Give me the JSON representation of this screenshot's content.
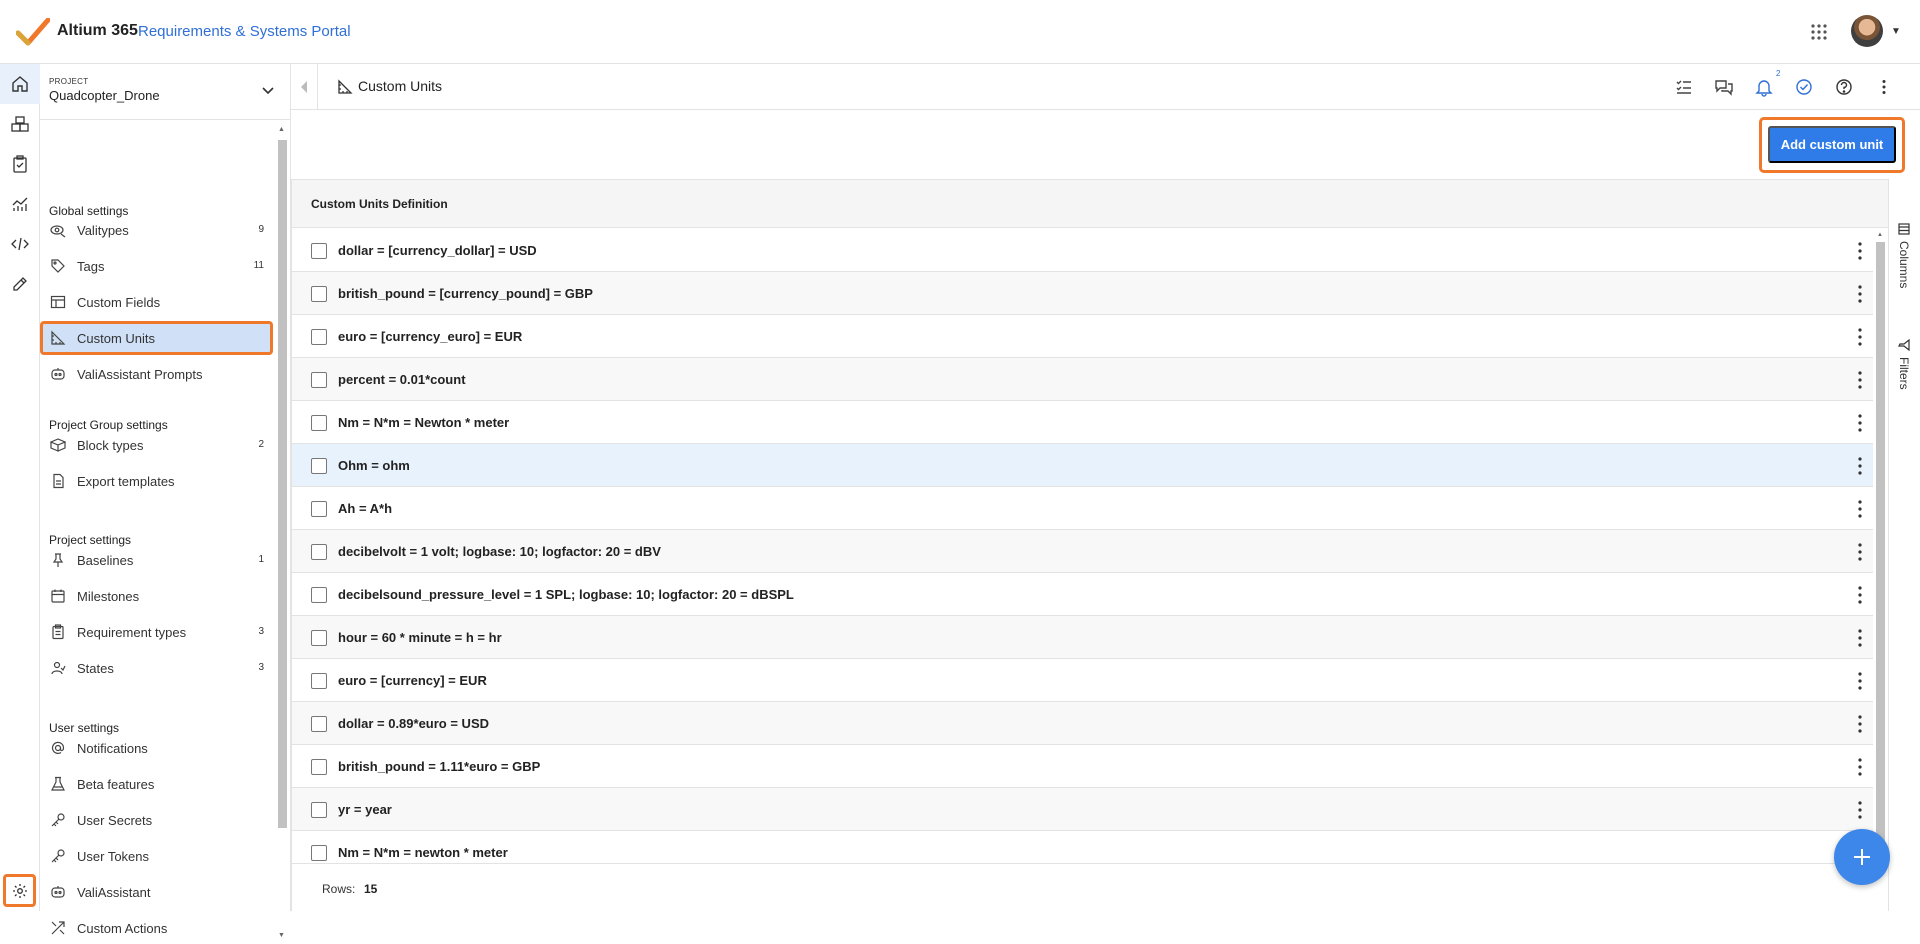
{
  "app": {
    "brand": "Altium 365",
    "portal": "Requirements & Systems Portal"
  },
  "project": {
    "label": "PROJECT",
    "name": "Quadcopter_Drone"
  },
  "sidebar": {
    "sections": {
      "global": "Global settings",
      "project_group": "Project Group settings",
      "project": "Project settings",
      "user": "User settings"
    },
    "items": [
      {
        "label": "Valitypes",
        "count": "9"
      },
      {
        "label": "Tags",
        "count": "11"
      },
      {
        "label": "Custom Fields",
        "count": ""
      },
      {
        "label": "Custom Units",
        "count": ""
      },
      {
        "label": "ValiAssistant Prompts",
        "count": ""
      },
      {
        "label": "Block types",
        "count": "2"
      },
      {
        "label": "Export templates",
        "count": ""
      },
      {
        "label": "Baselines",
        "count": "1"
      },
      {
        "label": "Milestones",
        "count": ""
      },
      {
        "label": "Requirement types",
        "count": "3"
      },
      {
        "label": "States",
        "count": "3"
      },
      {
        "label": "Notifications",
        "count": ""
      },
      {
        "label": "Beta features",
        "count": ""
      },
      {
        "label": "User Secrets",
        "count": ""
      },
      {
        "label": "User Tokens",
        "count": ""
      },
      {
        "label": "ValiAssistant",
        "count": ""
      },
      {
        "label": "Custom Actions",
        "count": ""
      }
    ]
  },
  "header": {
    "title": "Custom Units",
    "notification_count": "2"
  },
  "toolbar": {
    "add_label": "Add custom unit"
  },
  "table": {
    "column_header": "Custom Units Definition",
    "rows": [
      "dollar = [currency_dollar] = USD",
      "british_pound = [currency_pound] = GBP",
      "euro = [currency_euro] = EUR",
      "percent = 0.01*count",
      "Nm = N*m = Newton * meter",
      "Ohm = ohm",
      "Ah = A*h",
      "decibelvolt = 1 volt; logbase: 10; logfactor: 20 = dBV",
      "decibelsound_pressure_level = 1 SPL; logbase: 10; logfactor: 20 = dBSPL",
      "hour = 60 * minute = h = hr",
      "euro = [currency] = EUR",
      "dollar = 0.89*euro = USD",
      "british_pound = 1.11*euro = GBP",
      "yr = year",
      "Nm = N*m = newton * meter"
    ],
    "footer_label": "Rows:",
    "footer_count": "15"
  },
  "side_tabs": {
    "columns": "Columns",
    "filters": "Filters"
  },
  "colors": {
    "accent": "#2f7ce8",
    "highlight_outline": "#f0782a",
    "brand_check": "#f0782a"
  }
}
